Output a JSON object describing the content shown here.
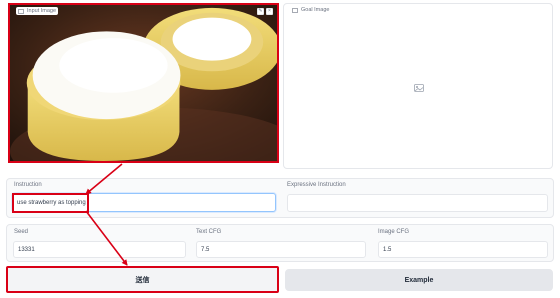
{
  "input_image": {
    "label": "Input Image",
    "tools": [
      "✎",
      "×"
    ]
  },
  "goal_image": {
    "label": "Goal Image"
  },
  "instruction": {
    "label": "Instruction",
    "value": "use strawberry as topping"
  },
  "expressive_instruction": {
    "label": "Expressive Instruction",
    "value": ""
  },
  "seed": {
    "label": "Seed",
    "value": "13331"
  },
  "text_cfg": {
    "label": "Text CFG",
    "value": "7.5"
  },
  "image_cfg": {
    "label": "Image CFG",
    "value": "1.5"
  },
  "buttons": {
    "submit": "送信",
    "example": "Example"
  },
  "colors": {
    "annotation_red": "#d90016"
  }
}
